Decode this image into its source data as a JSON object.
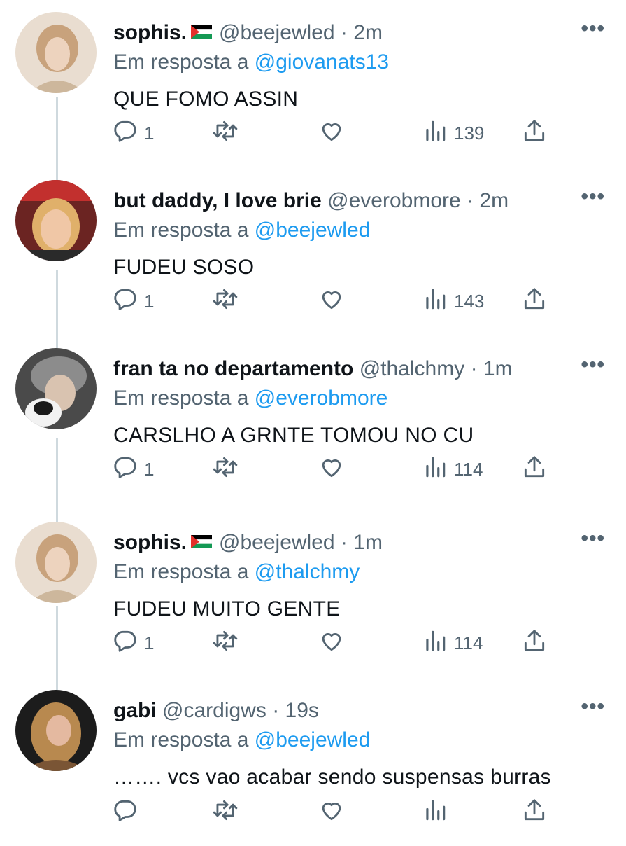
{
  "tweets": [
    {
      "name": "sophis.",
      "has_flag": true,
      "handle": "@beejewled",
      "time": "2m",
      "reply_prefix": "Em resposta a",
      "reply_to": "@giovanats13",
      "text": "QUE FOMO ASSIN",
      "replies": "1",
      "views": "139"
    },
    {
      "name": "but daddy, I love brie",
      "has_flag": false,
      "handle": "@everobmore",
      "time": "2m",
      "reply_prefix": "Em resposta a",
      "reply_to": "@beejewled",
      "text": "FUDEU SOSO",
      "replies": "1",
      "views": "143"
    },
    {
      "name": "fran ta no departamento",
      "has_flag": false,
      "handle": "@thalchmy",
      "time": "1m",
      "reply_prefix": "Em resposta a",
      "reply_to": "@everobmore",
      "text": "CARSLHO A GRNTE TOMOU NO CU",
      "replies": "1",
      "views": "114"
    },
    {
      "name": "sophis.",
      "has_flag": true,
      "handle": "@beejewled",
      "time": "1m",
      "reply_prefix": "Em resposta a",
      "reply_to": "@thalchmy",
      "text": "FUDEU MUITO GENTE",
      "replies": "1",
      "views": "114"
    },
    {
      "name": "gabi",
      "has_flag": false,
      "handle": "@cardigws",
      "time": "19s",
      "reply_prefix": "Em resposta a",
      "reply_to": "@beejewled",
      "text": "……. vcs vao acabar sendo suspensas burras",
      "replies": "",
      "views": ""
    }
  ],
  "ui": {
    "separator": "·",
    "more": "•••"
  },
  "icons": [
    "reply-icon",
    "retweet-icon",
    "like-icon",
    "views-icon",
    "share-icon",
    "more-icon",
    "palestine-flag-icon"
  ],
  "colors": {
    "text": "#0f1419",
    "secondary": "#536471",
    "link": "#1d9bf0",
    "thread_line": "#cfd9de"
  }
}
